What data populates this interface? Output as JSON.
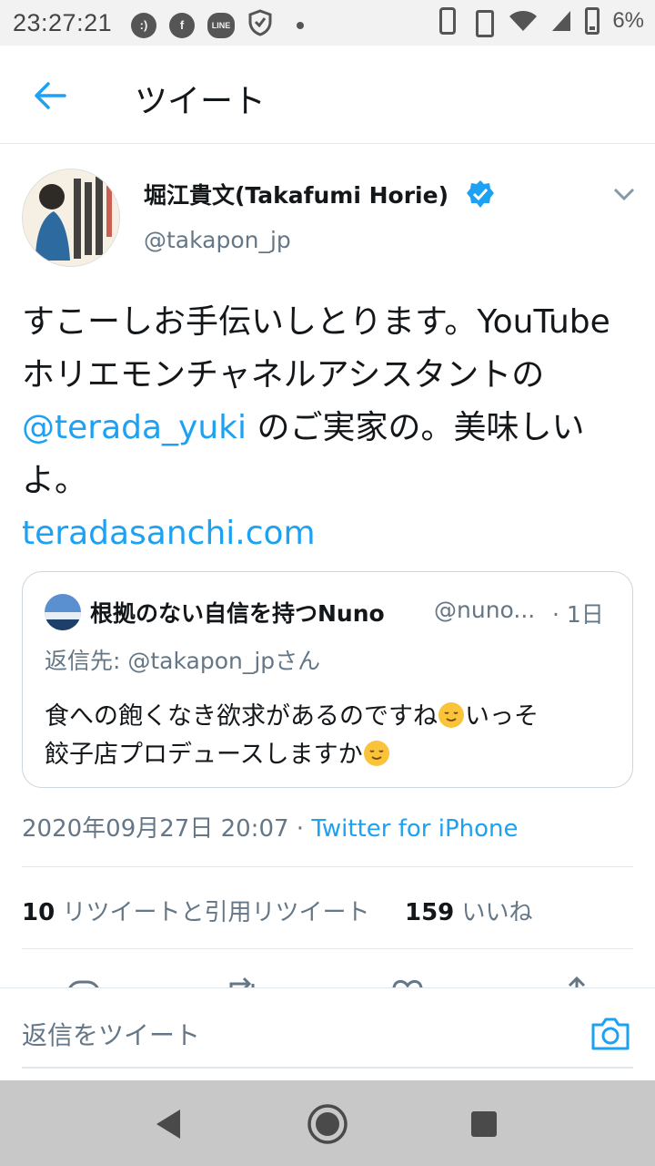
{
  "status_bar": {
    "time": "23:27:21",
    "battery": "6%",
    "left_icons": [
      "smiley-icon",
      "facebook-icon",
      "line-icon",
      "shield-icon",
      "dot-icon"
    ],
    "right_icons": [
      "phone-icon",
      "vibrate-icon",
      "wifi-icon",
      "signal-icon",
      "battery-icon"
    ]
  },
  "app_bar": {
    "title": "ツイート",
    "back_icon": "back-arrow-icon"
  },
  "tweet": {
    "author_name": "堀江貴文(Takafumi Horie)",
    "author_handle": "@takapon_jp",
    "verified": true,
    "text_before": "すこーしお手伝いしとります。YouTubeホリエモンチャネルアシスタントの ",
    "mention": "@terada_yuki",
    "text_after": " のご実家の。美味しいよ。",
    "link": "teradasanchi.com",
    "timestamp": "2020年09月27日 20:07 · ",
    "source": "Twitter for iPhone",
    "retweets_count": "10",
    "retweets_label": " リツイートと引用リツイート",
    "likes_count": "159",
    "likes_label": " いいね"
  },
  "quoted_tweet": {
    "author_name": "根拠のない自信を持つNuno",
    "author_handle": "@nuno...",
    "time": "· 1日",
    "reply_to": "返信先: @takapon_jpさん",
    "text_line1": "食への飽くなき欲求があるのですね",
    "text_line1b": "いっそ",
    "text_line2": "餃子店プロデュースしますか"
  },
  "reply_bar": {
    "placeholder": "返信をツイート",
    "camera_icon": "camera-icon"
  },
  "colors": {
    "accent": "#1da1f2",
    "text": "#14171a",
    "secondary": "#657786",
    "divider": "#e1e8ed"
  }
}
